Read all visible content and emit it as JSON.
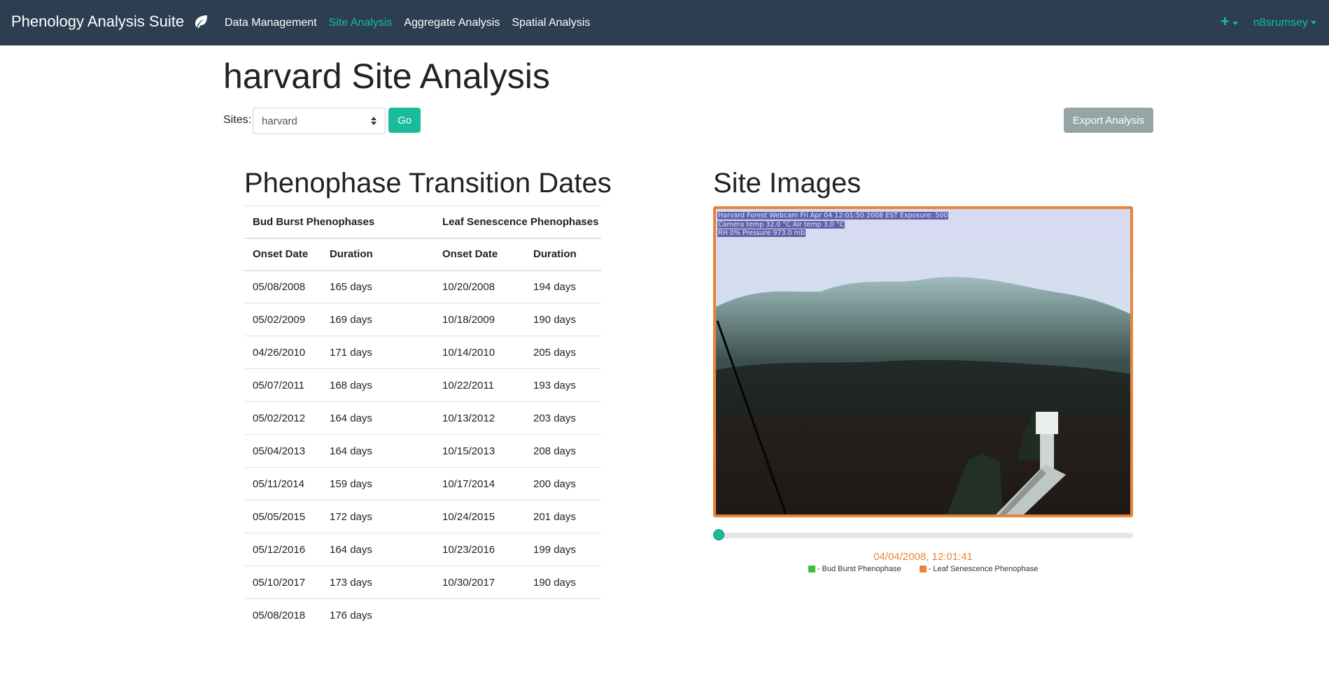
{
  "navbar": {
    "brand": "Phenology Analysis Suite",
    "brand_icon": "leaf-icon",
    "links": [
      "Data Management",
      "Site Analysis",
      "Aggregate Analysis",
      "Spatial Analysis"
    ],
    "active_link": "Site Analysis",
    "add_icon": "plus-icon",
    "user": "n8srumsey"
  },
  "page": {
    "title": "harvard Site Analysis",
    "sites_label": "Sites:",
    "selected_site": "harvard",
    "go_label": "Go",
    "export_label": "Export Analysis"
  },
  "transitions": {
    "title": "Phenophase Transition Dates",
    "group_headers": [
      "Bud Burst Phenophases",
      "Leaf Senescence Phenophases"
    ],
    "columns": [
      "Onset Date",
      "Duration",
      "Onset Date",
      "Duration"
    ],
    "rows": [
      [
        "05/08/2008",
        "165 days",
        "10/20/2008",
        "194 days"
      ],
      [
        "05/02/2009",
        "169 days",
        "10/18/2009",
        "190 days"
      ],
      [
        "04/26/2010",
        "171 days",
        "10/14/2010",
        "205 days"
      ],
      [
        "05/07/2011",
        "168 days",
        "10/22/2011",
        "193 days"
      ],
      [
        "05/02/2012",
        "164 days",
        "10/13/2012",
        "203 days"
      ],
      [
        "05/04/2013",
        "164 days",
        "10/15/2013",
        "208 days"
      ],
      [
        "05/11/2014",
        "159 days",
        "10/17/2014",
        "200 days"
      ],
      [
        "05/05/2015",
        "172 days",
        "10/24/2015",
        "201 days"
      ],
      [
        "05/12/2016",
        "164 days",
        "10/23/2016",
        "199 days"
      ],
      [
        "05/10/2017",
        "173 days",
        "10/30/2017",
        "190 days"
      ],
      [
        "05/08/2018",
        "176 days",
        "",
        ""
      ]
    ]
  },
  "images": {
    "title": "Site Images",
    "overlay": [
      "Harvard Forest Webcam Fri Apr 04 12:01:50 2008 EST Exposure: 500",
      "Camera temp 32.0 °C  Air temp 3.0 °C",
      "RH 0%      Pressure 973.0 mb"
    ],
    "slider_position": 0,
    "timestamp": "04/04/2008, 12:01:41",
    "legend": [
      {
        "label": "- Bud Burst Phenophase",
        "color": "#3fbf3f"
      },
      {
        "label": "- Leaf Senescence Phenophase",
        "color": "#e8843a"
      }
    ],
    "frame_color": "#e8843a"
  },
  "colors": {
    "navbar": "#2c3e50",
    "accent": "#18bc9c",
    "export_button": "#95a5a6"
  }
}
